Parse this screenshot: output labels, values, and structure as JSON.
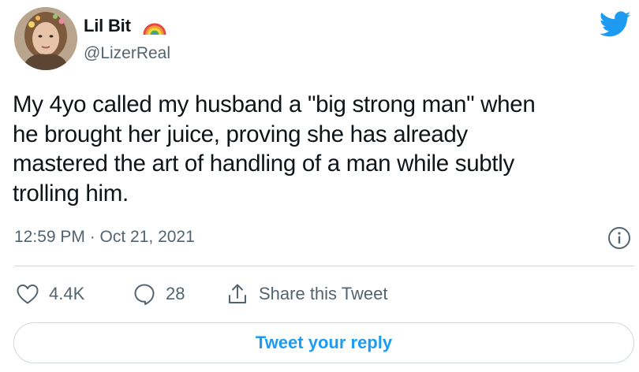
{
  "author": {
    "display_name": "Lil Bit",
    "handle": "@LizerReal",
    "badge_icon": "rainbow-icon",
    "avatar": "avatar-photo"
  },
  "platform_icon": "twitter-bird-icon",
  "tweet": {
    "text": "My 4yo called my husband a \"big strong man\" when\nhe brought her juice, proving she has already\nmastered the art of handling of a man while subtly\ntrolling him.",
    "timestamp": "12:59 PM · Oct 21, 2021"
  },
  "actions": {
    "like_count": "4.4K",
    "reply_count": "28",
    "share_label": "Share this Tweet",
    "reply_button_label": "Tweet your reply"
  },
  "colors": {
    "accent": "#1d9bf0",
    "text": "#0f1419",
    "secondary": "#536471",
    "divider": "#cfd9de"
  }
}
